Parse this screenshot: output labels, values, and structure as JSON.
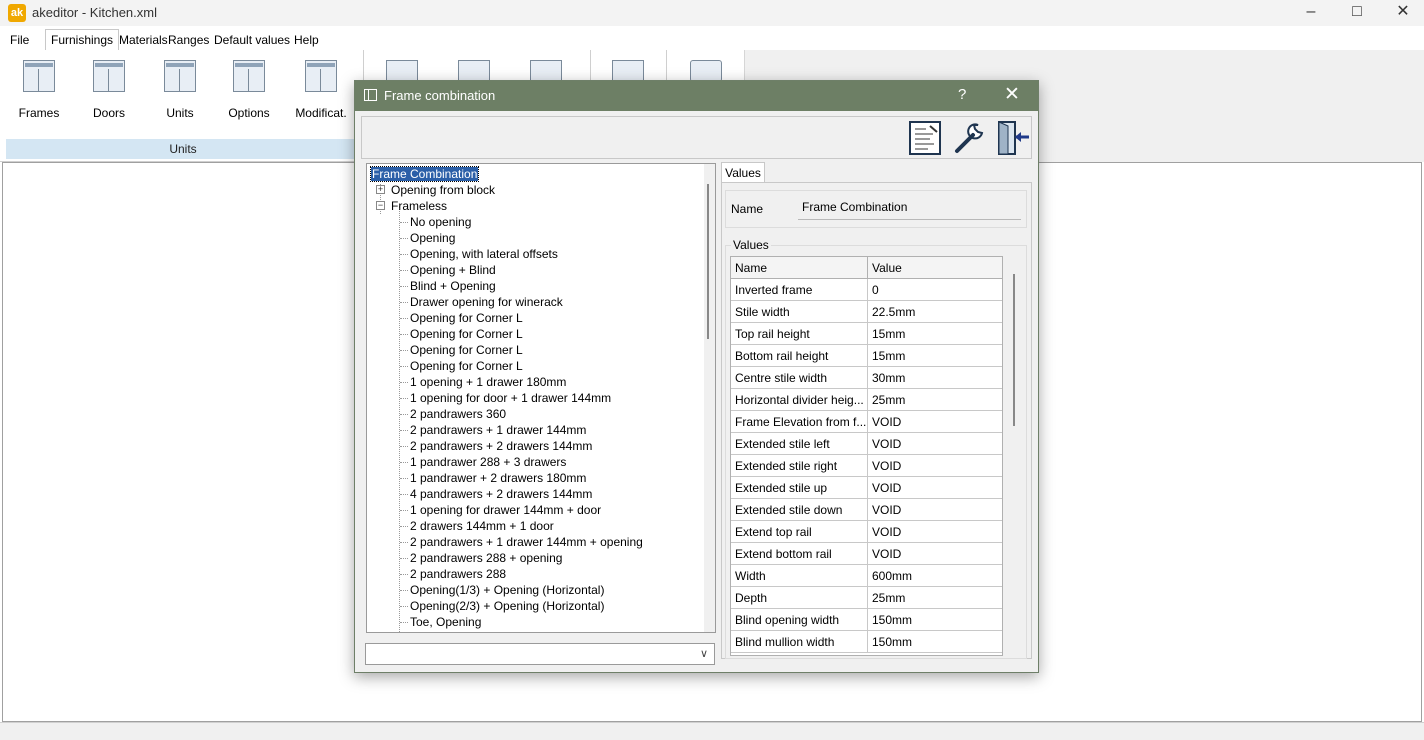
{
  "window": {
    "icon_text": "ak",
    "title": "akeditor - Kitchen.xml"
  },
  "menu": [
    "File",
    "Furnishings",
    "Materials",
    "Ranges",
    "Default values",
    "Help"
  ],
  "ribbon": {
    "buttons": [
      "Frames",
      "Doors",
      "Units",
      "Options",
      "Modificat."
    ],
    "group_label": "Units"
  },
  "dialog": {
    "title": "Frame combination",
    "help": "?",
    "tree": {
      "root": "Frame Combination",
      "nodes": [
        {
          "label": "Opening from block",
          "expander": "+"
        },
        {
          "label": "Frameless",
          "expander": "−"
        }
      ],
      "children": [
        "No opening",
        "Opening",
        "Opening, with lateral offsets",
        "Opening + Blind",
        "Blind + Opening",
        "Drawer opening for winerack",
        "Opening for Corner L",
        "Opening for Corner L",
        "Opening for Corner L",
        "Opening for Corner L",
        "1 opening + 1 drawer 180mm",
        "1 opening for door + 1 drawer 144mm",
        "2 pandrawers 360",
        "2 pandrawers  + 1 drawer 144mm",
        "2 pandrawers  + 2 drawers 144mm",
        "1 pandrawer 288 + 3 drawers",
        "1 pandrawer + 2 drawers 180mm",
        "4 pandrawers + 2 drawers 144mm",
        "1 opening for drawer 144mm + door",
        "2 drawers 144mm + 1 door",
        "2 pandrawers  + 1 drawer 144mm + opening",
        "2 pandrawers 288 + opening",
        "2 pandrawers 288",
        "Opening(1/3) + Opening (Horizontal)",
        "Opening(2/3) + Opening (Horizontal)",
        "Toe, Opening"
      ]
    },
    "tab": "Values",
    "name_label": "Name",
    "name_value": "Frame Combination",
    "values_group_label": "Values",
    "grid": {
      "headers": [
        "Name",
        "Value"
      ],
      "rows": [
        [
          "Inverted frame",
          "0"
        ],
        [
          "Stile width",
          "22.5mm"
        ],
        [
          "Top rail height",
          "15mm"
        ],
        [
          "Bottom rail height",
          "15mm"
        ],
        [
          "Centre stile width",
          "30mm"
        ],
        [
          "Horizontal divider heig...",
          "25mm"
        ],
        [
          "Frame Elevation from f...",
          "VOID"
        ],
        [
          "Extended stile left",
          "VOID"
        ],
        [
          "Extended stile right",
          "VOID"
        ],
        [
          "Extended stile up",
          "VOID"
        ],
        [
          "Extended stile down",
          "VOID"
        ],
        [
          "Extend top rail",
          "VOID"
        ],
        [
          "Extend bottom rail",
          "VOID"
        ],
        [
          "Width",
          "600mm"
        ],
        [
          "Depth",
          "25mm"
        ],
        [
          "Blind opening width",
          "150mm"
        ],
        [
          "Blind mullion width",
          "150mm"
        ]
      ]
    }
  }
}
